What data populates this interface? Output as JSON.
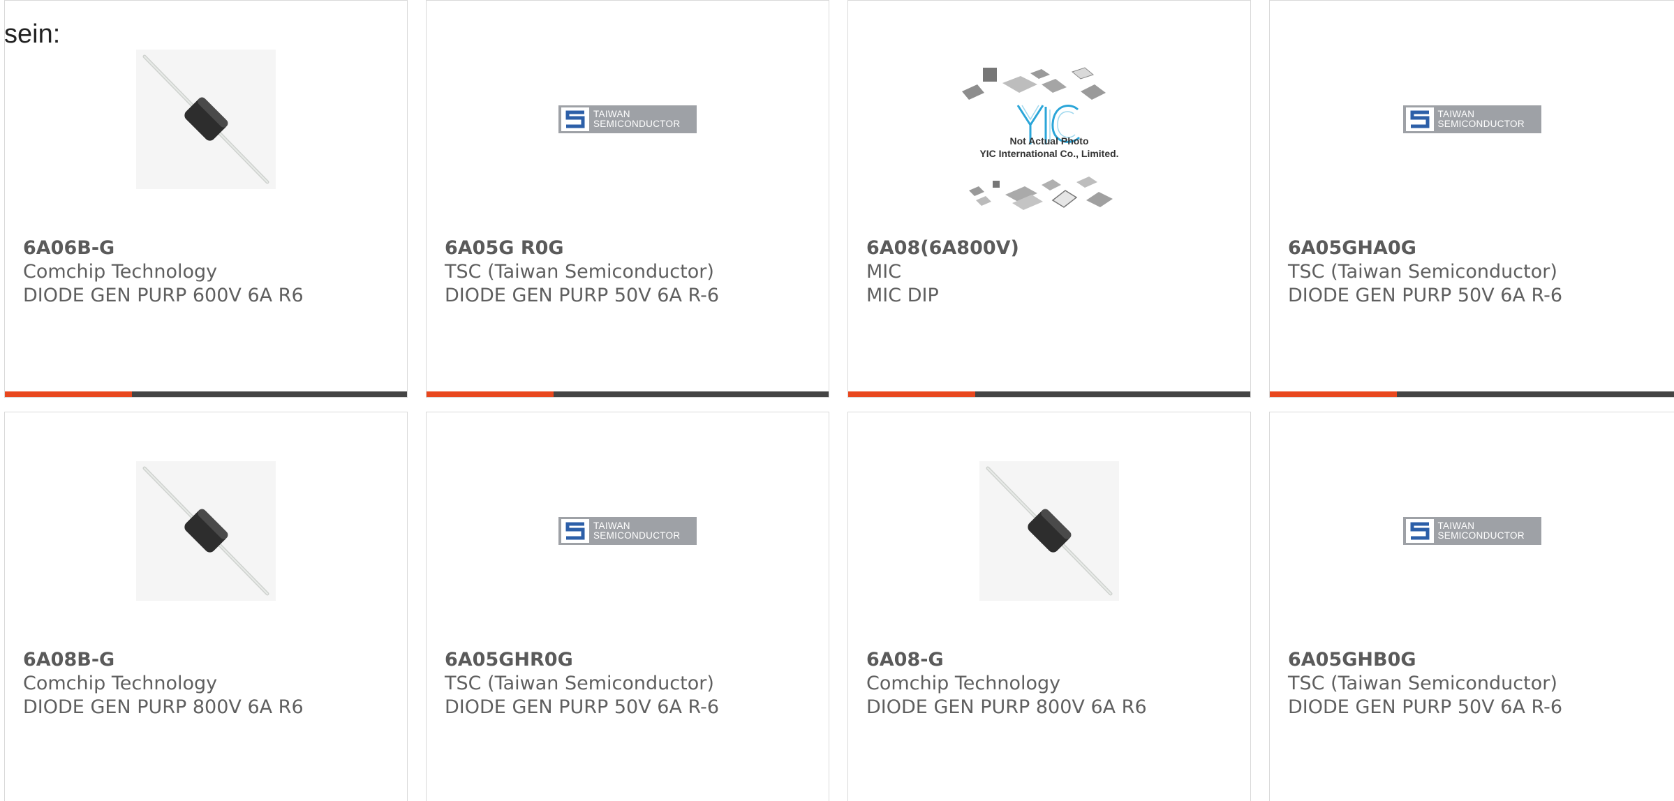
{
  "intro_text": "sein:",
  "colors": {
    "accent": "#e8471e",
    "bar": "#444444",
    "card_border": "#d9d9d9",
    "text": "#5f5f5f"
  },
  "products": [
    {
      "part_number": "6A06B-G",
      "manufacturer": "Comchip Technology",
      "description": "DIODE GEN PURP 600V 6A R6",
      "image": "diode-axial-photo"
    },
    {
      "part_number": "6A05G R0G",
      "manufacturer": "TSC (Taiwan Semiconductor)",
      "description": "DIODE GEN PURP 50V 6A R-6",
      "image": "taiwan-semiconductor-logo",
      "logo_text": [
        "TAIWAN",
        "SEMICONDUCTOR"
      ]
    },
    {
      "part_number": "6A08(6A800V)",
      "manufacturer": "MIC",
      "description": "MIC DIP",
      "image": "yic-placeholder",
      "placeholder_caption": [
        "Not Actual Photo",
        "YIC International Co., Limited."
      ]
    },
    {
      "part_number": "6A05GHA0G",
      "manufacturer": "TSC (Taiwan Semiconductor)",
      "description": "DIODE GEN PURP 50V 6A R-6",
      "image": "taiwan-semiconductor-logo",
      "logo_text": [
        "TAIWAN",
        "SEMICONDUCTOR"
      ]
    },
    {
      "part_number": "6A08B-G",
      "manufacturer": "Comchip Technology",
      "description": "DIODE GEN PURP 800V 6A R6",
      "image": "diode-axial-photo"
    },
    {
      "part_number": "6A05GHR0G",
      "manufacturer": "TSC (Taiwan Semiconductor)",
      "description": "DIODE GEN PURP 50V 6A R-6",
      "image": "taiwan-semiconductor-logo",
      "logo_text": [
        "TAIWAN",
        "SEMICONDUCTOR"
      ]
    },
    {
      "part_number": "6A08-G",
      "manufacturer": "Comchip Technology",
      "description": "DIODE GEN PURP 800V 6A R6",
      "image": "diode-axial-photo"
    },
    {
      "part_number": "6A05GHB0G",
      "manufacturer": "TSC (Taiwan Semiconductor)",
      "description": "DIODE GEN PURP 50V 6A R-6",
      "image": "taiwan-semiconductor-logo",
      "logo_text": [
        "TAIWAN",
        "SEMICONDUCTOR"
      ]
    }
  ]
}
